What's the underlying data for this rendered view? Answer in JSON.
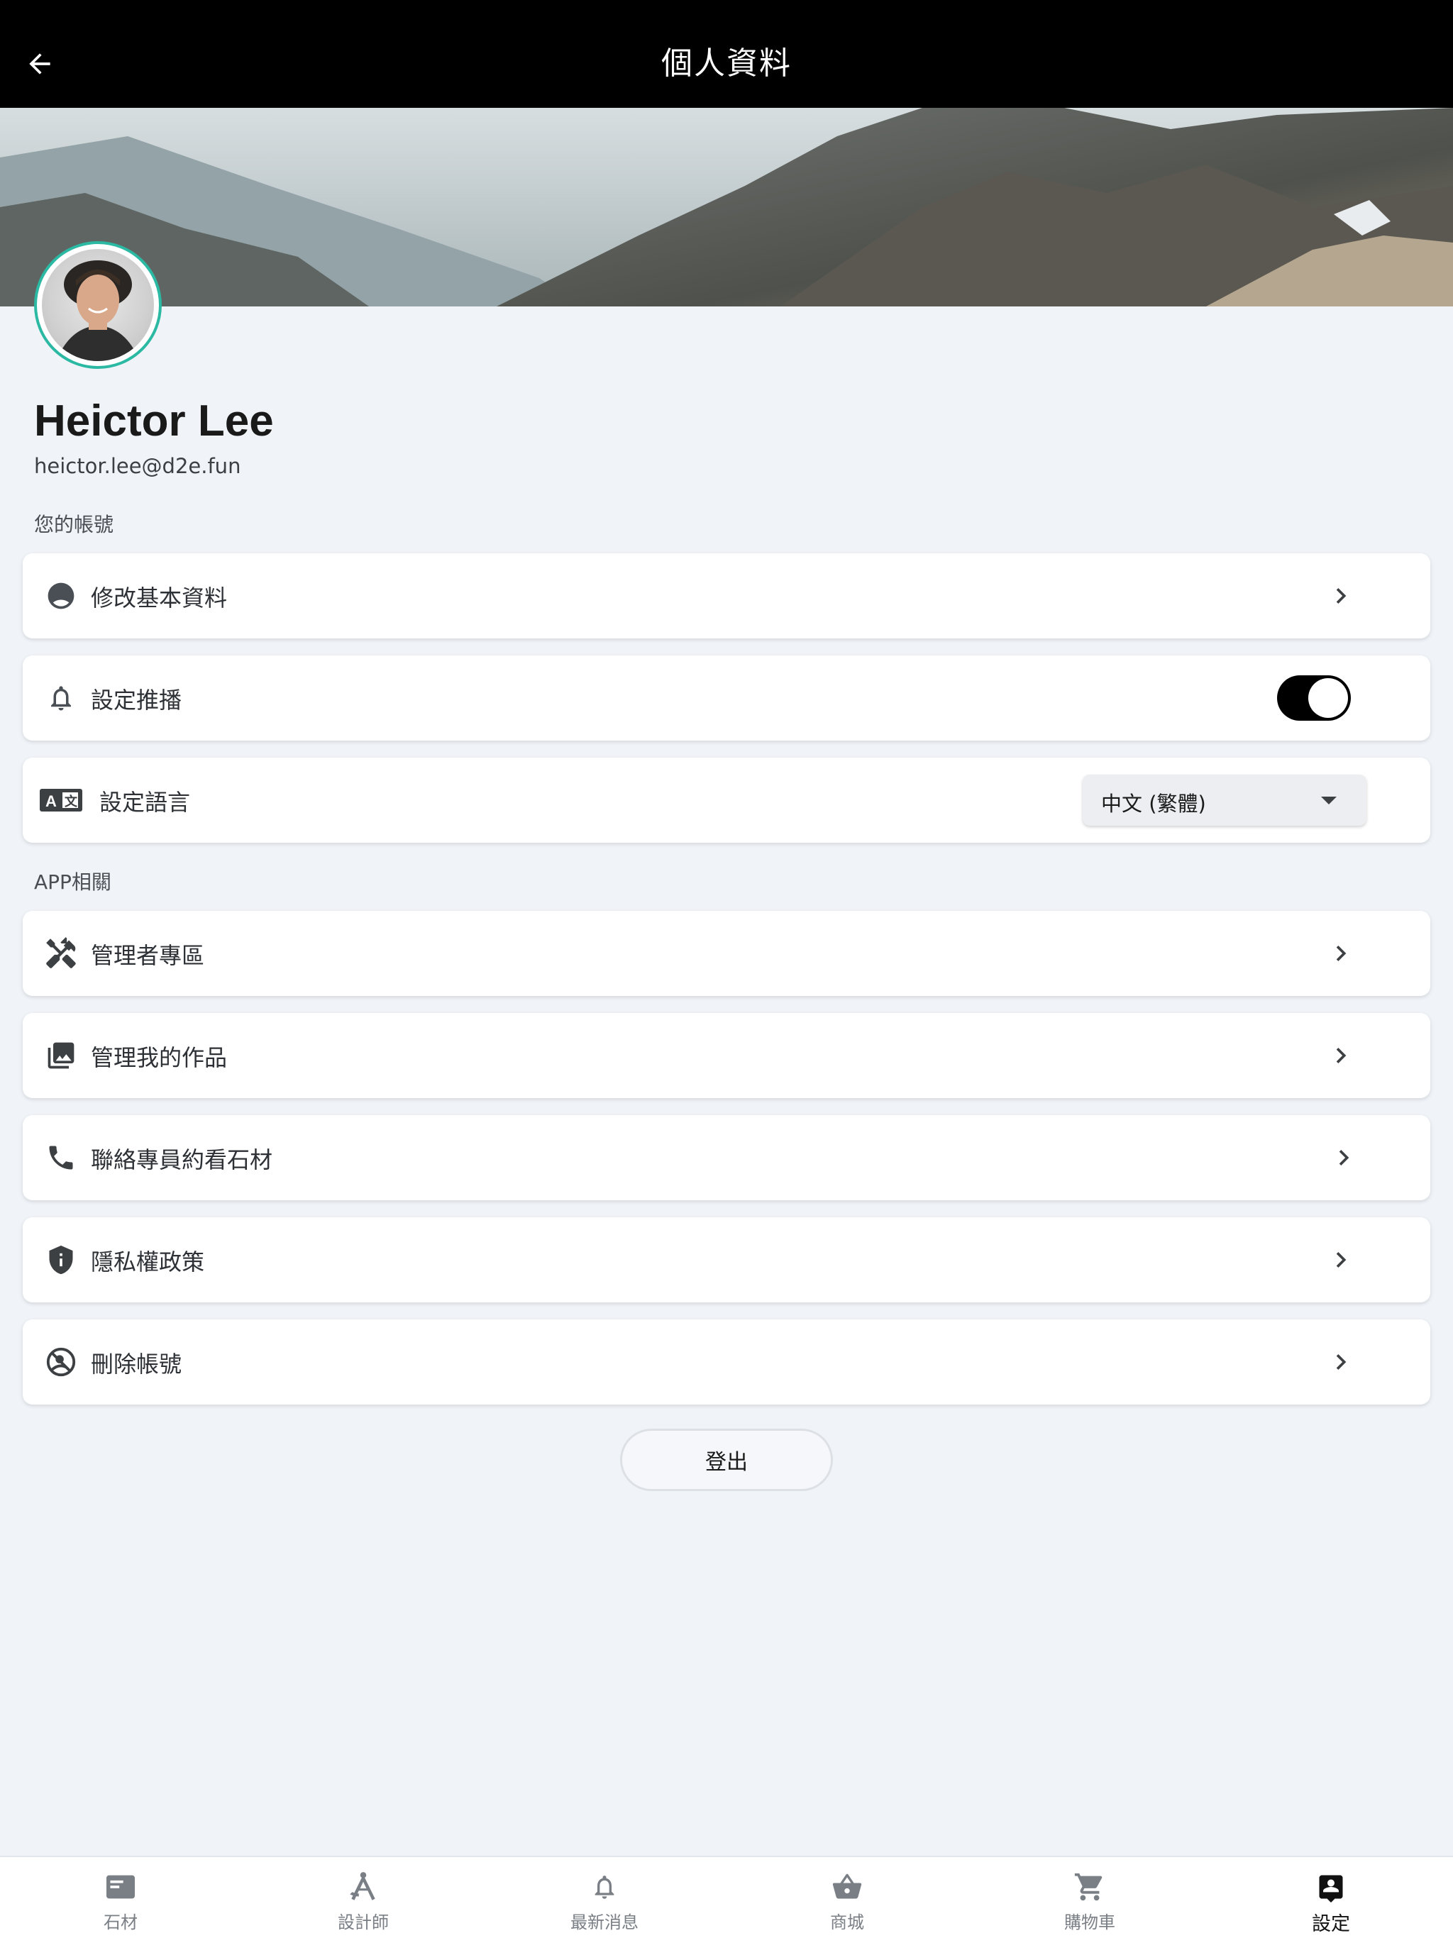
{
  "appbar": {
    "title": "個人資料",
    "back_icon": "arrow-back-icon"
  },
  "profile": {
    "name": "Heictor Lee",
    "email": "heictor.lee@d2e.fun"
  },
  "sections": {
    "account_label": "您的帳號",
    "app_label": "APP相關"
  },
  "account_items": [
    {
      "label": "修改基本資料",
      "icon": "account-circle-icon"
    },
    {
      "label": "設定推播",
      "icon": "bell-icon",
      "toggle_on": true
    },
    {
      "label": "設定語言",
      "icon": "translate-icon",
      "language": "中文 (繁體)"
    }
  ],
  "app_items": [
    {
      "label": "管理者專區",
      "icon": "tools-icon"
    },
    {
      "label": "管理我的作品",
      "icon": "photo-library-icon"
    },
    {
      "label": "聯絡專員約看石材",
      "icon": "phone-icon"
    },
    {
      "label": "隱私權政策",
      "icon": "shield-info-icon"
    },
    {
      "label": "刪除帳號",
      "icon": "block-user-icon"
    }
  ],
  "logout_label": "登出",
  "bottom_nav": [
    {
      "label": "石材",
      "icon": "stone-card-icon",
      "active": false
    },
    {
      "label": "設計師",
      "icon": "compass-draw-icon",
      "active": false
    },
    {
      "label": "最新消息",
      "icon": "bell-icon",
      "active": false
    },
    {
      "label": "商城",
      "icon": "basket-icon",
      "active": false
    },
    {
      "label": "購物車",
      "icon": "cart-icon",
      "active": false
    },
    {
      "label": "設定",
      "icon": "account-box-icon",
      "active": true
    }
  ],
  "colors": {
    "accent_ring": "#2bb9a3",
    "appbar_bg": "#000000",
    "page_bg": "#f0f3f8"
  }
}
